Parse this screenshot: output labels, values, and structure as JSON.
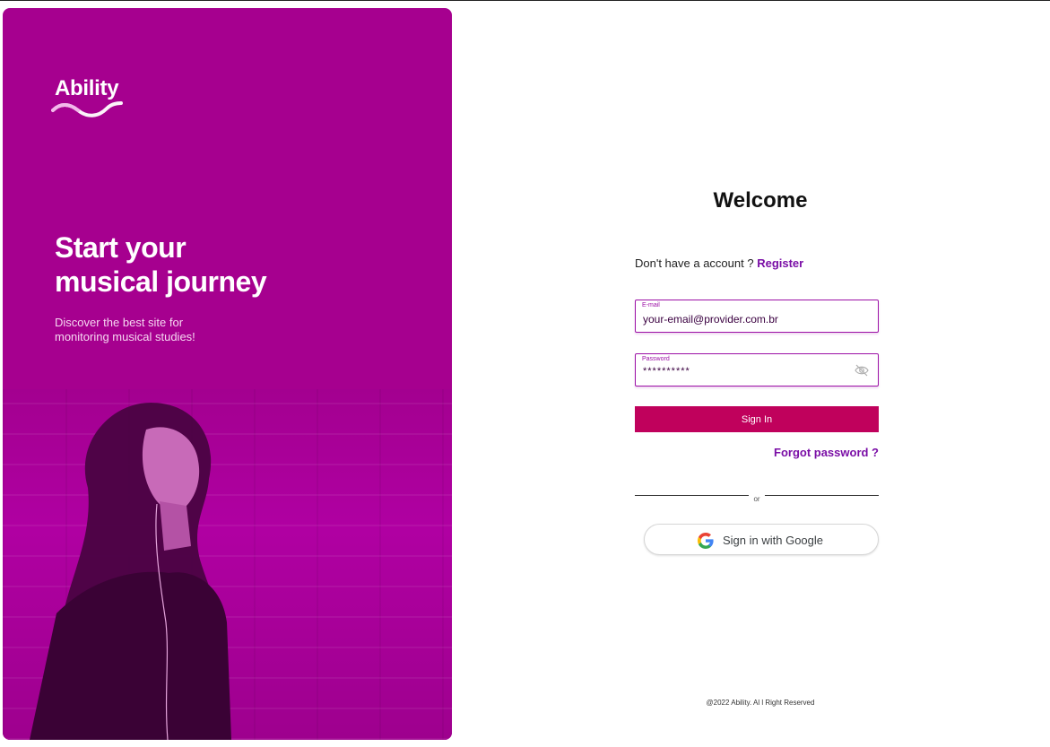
{
  "brand": {
    "name": "Ability"
  },
  "hero": {
    "title_line1": "Start your",
    "title_line2": "musical journey",
    "subtitle_line1": "Discover the best site for",
    "subtitle_line2": "monitoring musical studies!"
  },
  "form": {
    "welcome": "Welcome",
    "no_account": "Don't have a account ?",
    "register": "Register",
    "email_label": "E-mail",
    "email_value": "your-email@provider.com.br",
    "password_label": "Password",
    "password_value": "**********",
    "sign_in": "Sign In",
    "forgot": "Forgot password ?",
    "or": "or",
    "google": "Sign in with Google"
  },
  "footer": {
    "text": "@2022 Ability. Al l Right Reserved"
  },
  "colors": {
    "hero_bg": "#a6008f",
    "accent": "#9c10a6",
    "link": "#7a0ea6",
    "button": "#c0015c"
  },
  "icons": {
    "logo_wave": "wave-icon",
    "password_toggle": "eye-off-icon",
    "google": "google-icon"
  }
}
